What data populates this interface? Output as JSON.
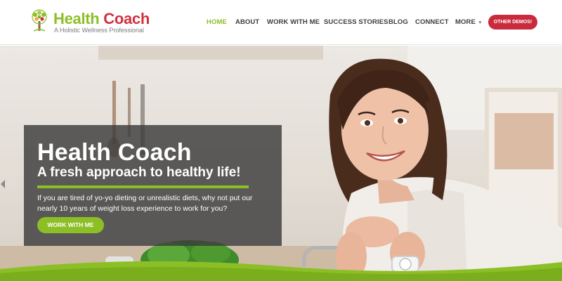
{
  "brand": {
    "name_part1": "Health",
    "name_part2": "Coach",
    "tagline": "A Holistic Wellness Professional",
    "colors": {
      "green": "#8cbf26",
      "red": "#d2303f",
      "button_red": "#c92a3c"
    }
  },
  "nav": {
    "items": [
      {
        "label": "HOME",
        "active": true
      },
      {
        "label": "ABOUT",
        "active": false
      },
      {
        "label": "WORK WITH ME",
        "active": false
      },
      {
        "label": "SUCCESS STORIES",
        "active": false
      },
      {
        "label": "BLOG",
        "active": false
      },
      {
        "label": "CONNECT",
        "active": false
      },
      {
        "label": "MORE",
        "active": false,
        "dropdown_icon": "chevron-down-icon"
      }
    ],
    "demo_button": "OTHER DEMOS!"
  },
  "hero": {
    "title": "Health Coach",
    "subtitle": "A fresh approach to healthy life!",
    "text": "If you are tired of yo-yo dieting or unrealistic diets, why not put our nearly 10 years of weight loss experience to work for you?",
    "cta": "WORK WITH ME",
    "slider_prev_icon": "chevron-left-icon"
  }
}
